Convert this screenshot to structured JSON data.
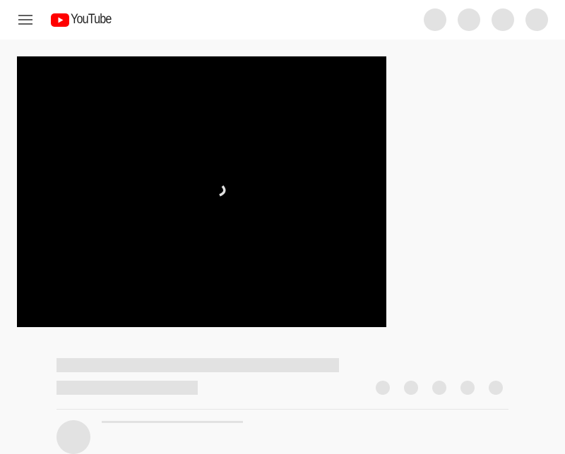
{
  "masthead": {
    "menu_icon": "hamburger-menu-icon",
    "logo": {
      "text": "YouTube",
      "brand_color": "#ff0000",
      "text_color": "#212121"
    },
    "action_placeholders": 4
  },
  "player": {
    "state": "loading",
    "background": "#000000",
    "spinner_icon": "loading-spinner-icon"
  },
  "watch_metadata": {
    "state": "skeleton-loading",
    "action_placeholders": 5,
    "placeholder_color": "#e2e2e2"
  }
}
